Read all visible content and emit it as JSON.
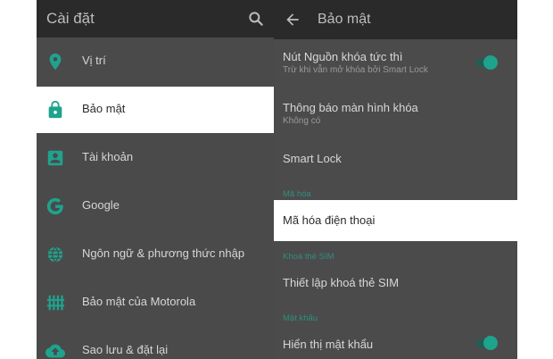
{
  "colors": {
    "accent": "#1ea38d",
    "section_header": "#2f8f7f",
    "selected_bg": "#ffffff"
  },
  "left": {
    "title": "Cài đặt",
    "search_icon": "search-icon",
    "items": [
      {
        "label": "Vị trí",
        "icon": "location-pin-icon"
      },
      {
        "label": "Bảo mật",
        "icon": "lock-icon",
        "selected": true
      },
      {
        "label": "Tài khoản",
        "icon": "account-box-icon"
      },
      {
        "label": "Google",
        "icon": "google-icon"
      },
      {
        "label": "Ngôn ngữ & phương thức nhập",
        "icon": "globe-icon"
      },
      {
        "label": "Bảo mật của Motorola",
        "icon": "grid-lines-icon"
      },
      {
        "label": "Sao lưu & đặt lại",
        "icon": "cloud-upload-icon"
      }
    ]
  },
  "right": {
    "title": "Bảo mật",
    "back_icon": "back-arrow-icon",
    "power_lock": {
      "title": "Nút Nguồn khóa tức thì",
      "subtitle": "Trừ khi vẫn mở khóa bởi Smart Lock",
      "toggle_on": true
    },
    "lock_screen_notif": {
      "title": "Thông báo màn hình khóa",
      "subtitle": "Không có"
    },
    "smart_lock": {
      "title": "Smart Lock"
    },
    "encryption_header": "Mã hóa",
    "encrypt_phone": {
      "title": "Mã hóa điện thoại"
    },
    "sim_lock_header": "Khoá thẻ SIM",
    "sim_lock_setup": {
      "title": "Thiết lập khoá thẻ SIM"
    },
    "password_header": "Mật khẩu",
    "show_password": {
      "title": "Hiển thị mật khẩu",
      "toggle_on": true
    }
  }
}
